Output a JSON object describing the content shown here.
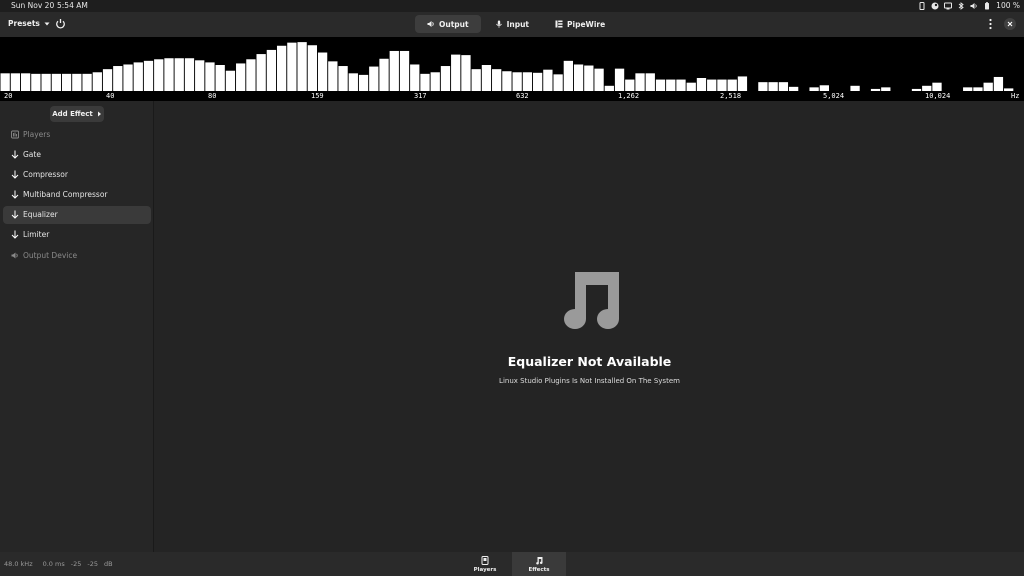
{
  "system": {
    "date": "Sun Nov 20",
    "time": "5:54 AM",
    "battery": "100 %"
  },
  "header": {
    "presets_label": "Presets",
    "tabs": [
      {
        "label": "Output",
        "icon": "speaker-icon",
        "active": true
      },
      {
        "label": "Input",
        "icon": "microphone-icon",
        "active": false
      },
      {
        "label": "PipeWire",
        "icon": "pipewire-icon",
        "active": false
      }
    ]
  },
  "spectrum": {
    "bar_color": "#ffffff",
    "levels": [
      0.34,
      0.34,
      0.34,
      0.33,
      0.33,
      0.33,
      0.33,
      0.33,
      0.33,
      0.36,
      0.42,
      0.48,
      0.51,
      0.55,
      0.58,
      0.61,
      0.63,
      0.63,
      0.63,
      0.59,
      0.55,
      0.5,
      0.39,
      0.53,
      0.61,
      0.71,
      0.79,
      0.87,
      0.93,
      0.94,
      0.88,
      0.74,
      0.57,
      0.48,
      0.34,
      0.31,
      0.47,
      0.62,
      0.77,
      0.77,
      0.51,
      0.33,
      0.36,
      0.48,
      0.7,
      0.69,
      0.42,
      0.5,
      0.42,
      0.38,
      0.36,
      0.36,
      0.35,
      0.41,
      0.32,
      0.58,
      0.51,
      0.49,
      0.43,
      0.1,
      0.43,
      0.22,
      0.34,
      0.34,
      0.22,
      0.22,
      0.22,
      0.16,
      0.25,
      0.22,
      0.22,
      0.22,
      0.28,
      0.0,
      0.17,
      0.17,
      0.17,
      0.08,
      0.0,
      0.07,
      0.11,
      0.0,
      0.0,
      0.1,
      0.0,
      0.04,
      0.07,
      0.0,
      0.0,
      0.04,
      0.1,
      0.16,
      0.0,
      0.0,
      0.07,
      0.07,
      0.16,
      0.27,
      0.05,
      0.0
    ],
    "labels": [
      "20",
      "40",
      "80",
      "159",
      "317",
      "632",
      "1,262",
      "2,518",
      "5,024",
      "10,024",
      "Hz"
    ]
  },
  "sidebar": {
    "add_effect_label": "Add Effect",
    "items": [
      {
        "label": "Players",
        "icon": "players-icon",
        "state": "dim"
      },
      {
        "label": "Gate",
        "icon": "arrow-down-icon",
        "state": "normal"
      },
      {
        "label": "Compressor",
        "icon": "arrow-down-icon",
        "state": "normal"
      },
      {
        "label": "Multiband Compressor",
        "icon": "arrow-down-icon",
        "state": "normal"
      },
      {
        "label": "Equalizer",
        "icon": "arrow-down-icon",
        "state": "selected"
      },
      {
        "label": "Limiter",
        "icon": "arrow-down-icon",
        "state": "normal"
      },
      {
        "label": "Output Device",
        "icon": "speaker-icon",
        "state": "dim"
      }
    ]
  },
  "main": {
    "title": "Equalizer Not Available",
    "subtitle": "Linux Studio Plugins Is Not Installed On The System"
  },
  "status": {
    "rate": "48.0 kHz",
    "latency": "0.0 ms",
    "left_db": "-25",
    "right_db": "-25",
    "unit": "dB"
  },
  "bottom": {
    "players_label": "Players",
    "effects_label": "Effects"
  }
}
